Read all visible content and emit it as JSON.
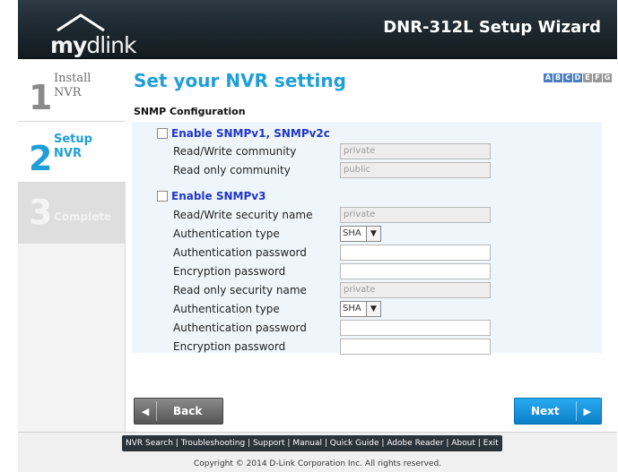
{
  "header": {
    "logo_my": "my",
    "logo_dlink": "dlink",
    "title": "DNR-312L Setup Wizard"
  },
  "sidebar": {
    "steps": [
      {
        "num": "1",
        "label": "Install NVR"
      },
      {
        "num": "2",
        "label": "Setup NVR"
      },
      {
        "num": "3",
        "label": "Complete"
      }
    ]
  },
  "main": {
    "title": "Set your NVR setting",
    "languages": [
      "A",
      "B",
      "C",
      "D",
      "E",
      "F",
      "G"
    ],
    "section_title": "SNMP Configuration"
  },
  "snmp_v1v2c": {
    "checkbox_label": "Enable SNMPv1, SNMPv2c",
    "rw_community_label": "Read/Write community",
    "rw_community_value": "private",
    "ro_community_label": "Read only community",
    "ro_community_value": "public"
  },
  "snmp_v3": {
    "checkbox_label": "Enable SNMPv3",
    "rw_security_name_label": "Read/Write security name",
    "rw_security_name_value": "private",
    "auth_type_label": "Authentication type",
    "auth_type_value": "SHA",
    "auth_password_label": "Authentication password",
    "enc_password_label": "Encryption password",
    "ro_security_name_label": "Read only security name",
    "ro_security_name_value": "private",
    "auth_type2_label": "Authentication type",
    "auth_type2_value": "SHA",
    "auth_password2_label": "Authentication password",
    "enc_password2_label": "Encryption password"
  },
  "buttons": {
    "back": "Back",
    "next": "Next"
  },
  "footer": {
    "links": [
      "NVR Search",
      "Troubleshooting",
      "Support",
      "Manual",
      "Quick Guide",
      "Adobe Reader",
      "About",
      "Exit"
    ],
    "copyright": "Copyright © 2014 D-Link Corporation Inc. All rights reserved."
  }
}
